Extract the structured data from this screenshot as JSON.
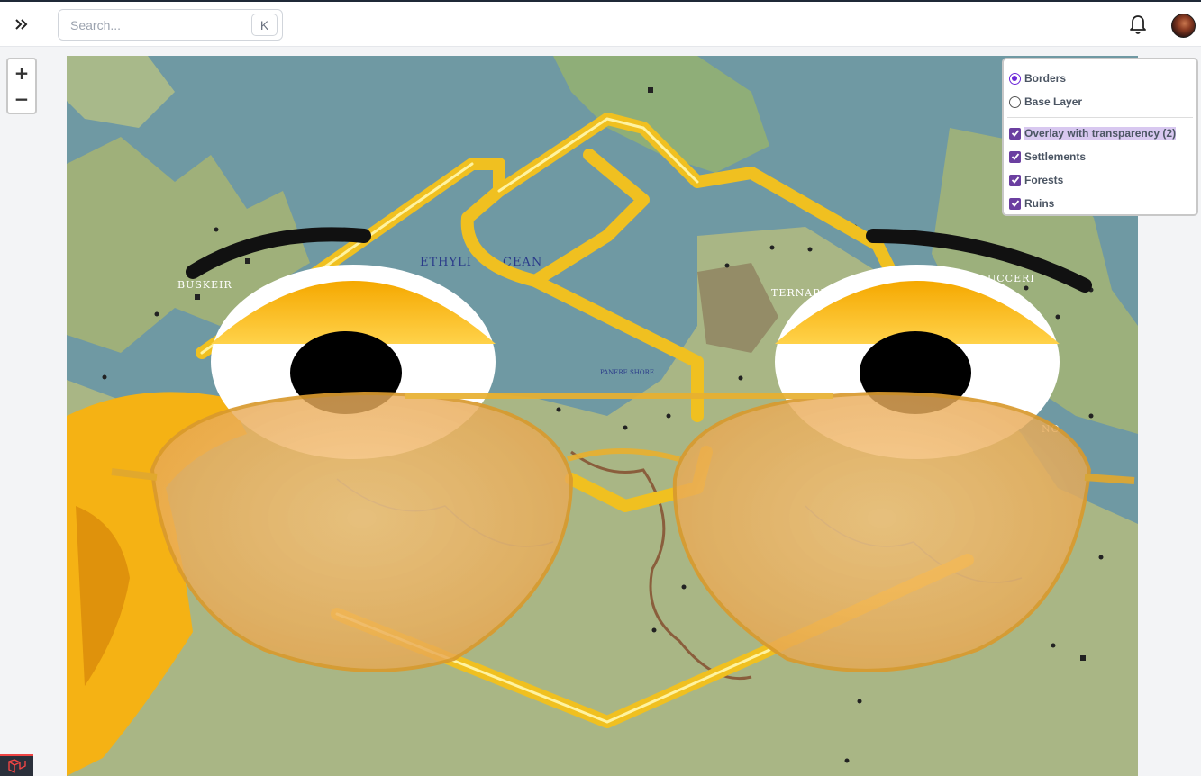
{
  "topbar": {
    "search_placeholder": "Search...",
    "search_shortcut": "K",
    "expand_icon": "double-chevron-right-icon",
    "bell_icon": "bell-icon",
    "avatar": "user-avatar"
  },
  "map_controls": {
    "zoom_in": "+",
    "zoom_out": "−"
  },
  "map": {
    "labels": [
      "ETHYLI",
      "CEAN",
      "BUSKEIR",
      "TERNAPP",
      "UCCERI",
      "PANERE SHORE",
      "NO"
    ],
    "overlay": "cartoon face with aviator sunglasses"
  },
  "layers": {
    "base_layers": [
      {
        "label": "Borders",
        "selected": true
      },
      {
        "label": "Base Layer",
        "selected": false
      }
    ],
    "overlays": [
      {
        "label": "Overlay with transparency (2)",
        "checked": true
      },
      {
        "label": "Settlements",
        "checked": true
      },
      {
        "label": "Forests",
        "checked": true
      },
      {
        "label": "Ruins",
        "checked": true
      }
    ]
  },
  "colors": {
    "accent": "#6d28d9",
    "sea": "#6f99a3",
    "land": "#9fb07a",
    "gold": "#f5c518"
  }
}
